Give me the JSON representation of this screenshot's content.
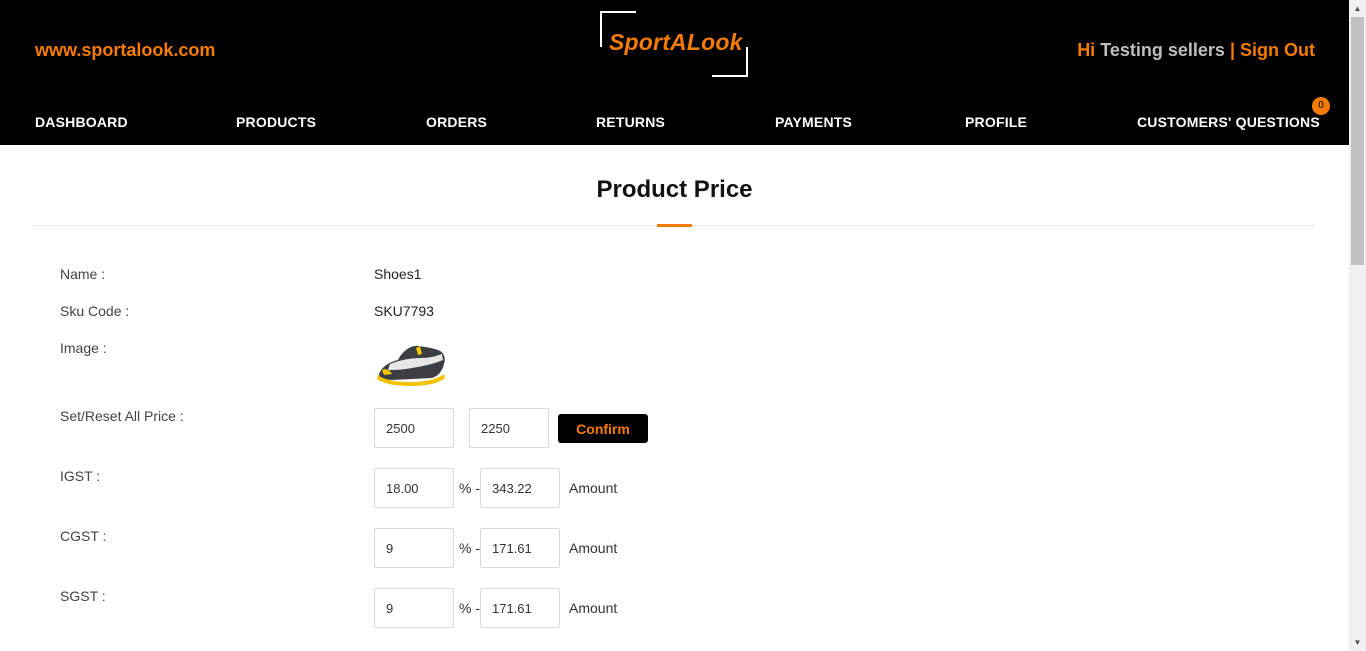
{
  "header": {
    "site_url": "www.sportalook.com",
    "logo_text": "SportALook",
    "greeting": "Hi",
    "user_name": "Testing sellers",
    "separator": "|",
    "sign_out": "Sign Out"
  },
  "nav": {
    "items": [
      {
        "label": "DASHBOARD"
      },
      {
        "label": "PRODUCTS"
      },
      {
        "label": "ORDERS"
      },
      {
        "label": "RETURNS"
      },
      {
        "label": "PAYMENTS"
      },
      {
        "label": "PROFILE"
      },
      {
        "label": "CUSTOMERS' QUESTIONS"
      }
    ],
    "questions_badge": "0"
  },
  "page": {
    "title": "Product Price"
  },
  "product": {
    "name_label": "Name :",
    "name": "Shoes1",
    "sku_label": "Sku Code :",
    "sku": "SKU7793",
    "image_label": "Image :"
  },
  "pricing": {
    "set_reset_label": "Set/Reset All Price :",
    "price_1": "2500",
    "price_2": "2250",
    "confirm_label": "Confirm",
    "igst_label": "IGST :",
    "igst_percent": "18.00",
    "igst_amount": "343.22",
    "cgst_label": "CGST :",
    "cgst_percent": "9",
    "cgst_amount": "171.61",
    "sgst_label": "SGST :",
    "sgst_percent": "9",
    "sgst_amount": "171.61",
    "percent_sep": "% -",
    "amount_label": "Amount"
  },
  "colors": {
    "accent": "#f57c00",
    "header_bg": "#000000"
  }
}
